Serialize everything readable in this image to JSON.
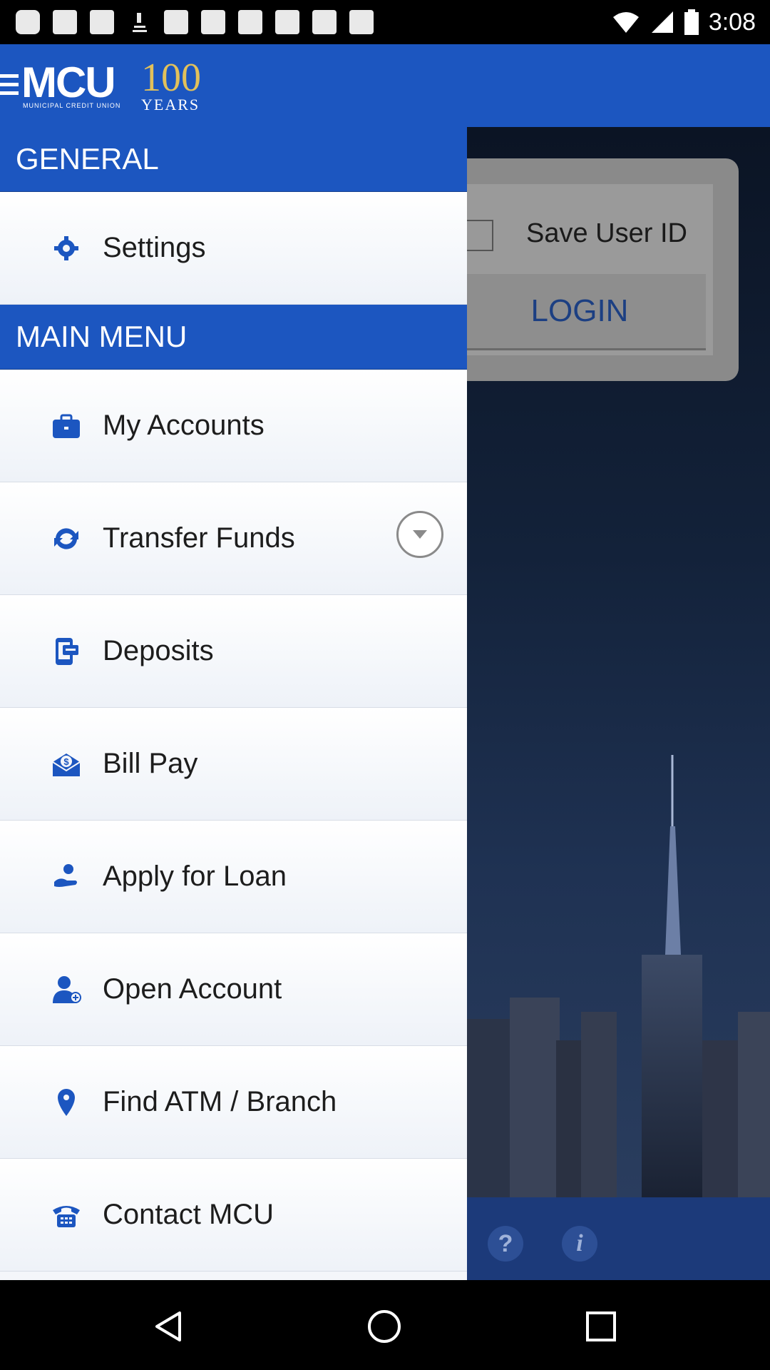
{
  "status_bar": {
    "time": "3:08"
  },
  "app_bar": {
    "logo_text": "MCU",
    "logo_subtext": "MUNICIPAL CREDIT UNION",
    "anniversary_number": "100",
    "anniversary_word": "YEARS"
  },
  "login_panel": {
    "save_user_id_label": "Save User ID",
    "login_button_label": "LOGIN"
  },
  "drawer": {
    "general_header": "GENERAL",
    "settings_label": "Settings",
    "main_menu_header": "MAIN MENU",
    "items": [
      {
        "label": "My Accounts",
        "icon": "briefcase-icon"
      },
      {
        "label": "Transfer Funds",
        "icon": "refresh-icon",
        "expandable": true
      },
      {
        "label": "Deposits",
        "icon": "mobile-deposit-icon"
      },
      {
        "label": "Bill Pay",
        "icon": "envelope-dollar-icon"
      },
      {
        "label": "Apply for Loan",
        "icon": "hand-money-icon"
      },
      {
        "label": "Open Account",
        "icon": "add-user-icon"
      },
      {
        "label": "Find ATM / Branch",
        "icon": "map-pin-icon"
      },
      {
        "label": "Contact MCU",
        "icon": "phone-icon"
      }
    ]
  },
  "bottom_actions": {
    "help_icon": "?",
    "info_icon": "i"
  },
  "colors": {
    "brand_blue": "#1c56c0",
    "logo_gold": "#e2c15b",
    "login_text": "#1c3f82"
  }
}
